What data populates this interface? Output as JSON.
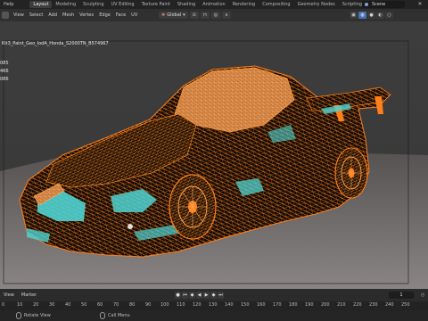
{
  "topbar": {
    "help": "Help",
    "tabs": [
      "Layout",
      "Modeling",
      "Sculpting",
      "UV Editing",
      "Texture Paint",
      "Shading",
      "Animation",
      "Rendering",
      "Compositing",
      "Geometry Nodes",
      "Scripting"
    ],
    "active_tab": "Layout",
    "scene_label": "Scene"
  },
  "header": {
    "view": "View",
    "select": "Select",
    "add": "Add",
    "mesh": "Mesh",
    "vertex": "Vertex",
    "edge": "Edge",
    "face": "Face",
    "uv": "UV",
    "transform_orientation": "Global"
  },
  "viewport": {
    "object_name": "Kit3_Paint_Geo_lodA_Honda_S2000TN_B574967",
    "stats": [
      "085",
      "466",
      "086"
    ],
    "wire_color": "#ff7f1a",
    "selected_face_color": "#4fd3d2",
    "background_color": "#3b3b3b"
  },
  "timeline": {
    "view": "View",
    "marker": "Marker",
    "current_frame": "1"
  },
  "ruler": {
    "ticks": [
      "0",
      "10",
      "20",
      "30",
      "40",
      "50",
      "60",
      "70",
      "80",
      "90",
      "100",
      "110",
      "120",
      "130",
      "140",
      "150",
      "160",
      "170",
      "180",
      "190",
      "200",
      "210",
      "220",
      "230",
      "240",
      "250"
    ]
  },
  "status": {
    "rotate_view": "Rotate View",
    "call_menu": "Call Menu"
  }
}
